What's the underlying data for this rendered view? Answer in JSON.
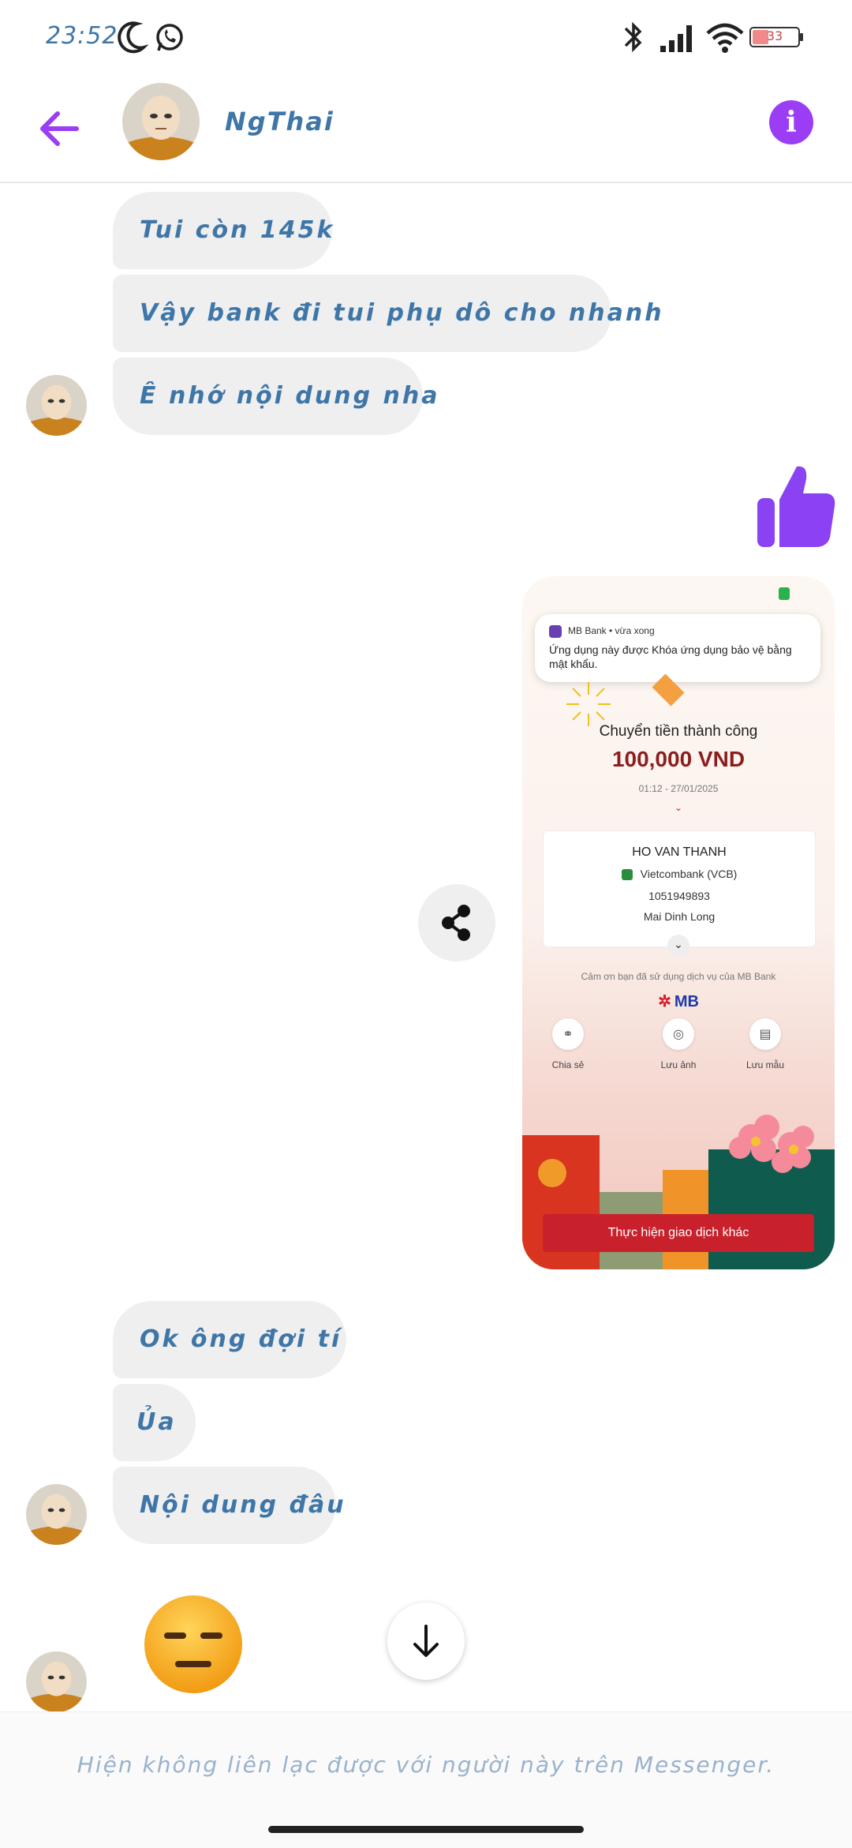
{
  "status_bar": {
    "time": "23:52",
    "battery": "33"
  },
  "header": {
    "contact_name": "NgThai"
  },
  "messages": [
    {
      "text": "Tui còn 145k"
    },
    {
      "text": "Vậy bank đi tui phụ dô cho nhanh"
    },
    {
      "text": "Ê nhớ nội dung nha"
    },
    {
      "text": "Ok ông đợi tí"
    },
    {
      "text": "Ủa"
    },
    {
      "text": "Nội dung đâu"
    }
  ],
  "receipt": {
    "notification_app": "MB Bank • vừa xong",
    "notification_text": "Ứng dụng này được Khóa ứng dụng bảo vệ bằng mật khẩu.",
    "title": "Chuyển tiền thành công",
    "amount": "100,000 VND",
    "datetime": "01:12 - 27/01/2025",
    "recipient_name": "HO VAN THANH",
    "bank": "Vietcombank (VCB)",
    "account_number": "1051949893",
    "recipient_extra": "Mai Dinh Long",
    "thanks": "Cảm ơn bạn đã sử dụng dịch vụ của MB Bank",
    "brand": "MB",
    "actions": [
      "Chia sẻ",
      "Lưu ảnh",
      "Lưu mẫu"
    ],
    "cta": "Thực hiện giao dịch khác"
  },
  "footer": {
    "text": "Hiện không liên lạc được với người này trên Messenger."
  },
  "colors": {
    "accent": "#9b3df4",
    "bubble": "#efefef",
    "text": "#3f76a8"
  }
}
